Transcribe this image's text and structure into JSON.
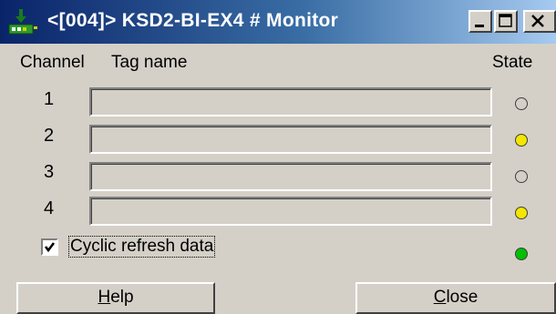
{
  "window": {
    "title": "<[004]> KSD2-BI-EX4 # Monitor",
    "icon": "network-device-icon",
    "controls": [
      "minimize-icon",
      "maximize-icon",
      "close-icon"
    ]
  },
  "table": {
    "headers": {
      "channel": "Channel",
      "tag_name": "Tag name",
      "state": "State"
    },
    "rows": [
      {
        "channel": "1",
        "tag_name": "",
        "state_color": "#d4d0c8"
      },
      {
        "channel": "2",
        "tag_name": "",
        "state_color": "#f5e600"
      },
      {
        "channel": "3",
        "tag_name": "",
        "state_color": "#d4d0c8"
      },
      {
        "channel": "4",
        "tag_name": "",
        "state_color": "#f5e600"
      }
    ]
  },
  "cyclic_refresh": {
    "label": "Cyclic refresh data",
    "checked": true,
    "indicator_color": "#00c000"
  },
  "buttons": {
    "help": {
      "accel": "H",
      "rest": "elp"
    },
    "close": {
      "accel": "C",
      "rest": "lose"
    }
  }
}
